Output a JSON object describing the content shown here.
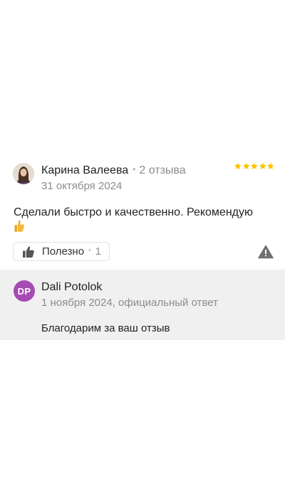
{
  "review": {
    "author_name": "Карина Валеева",
    "separator": "•",
    "reviews_count": "2 отзыва",
    "rating": 5,
    "star_color": "#fcc200",
    "date": "31 октября 2024",
    "text": "Сделали быстро и качественно. Рекомендую",
    "text_emoji": "thumbs-up-emoji",
    "helpful": {
      "label": "Полезно",
      "separator": "•",
      "count": "1"
    },
    "report_icon": "warning-icon"
  },
  "reply": {
    "avatar_initials": "DP",
    "avatar_color": "#a54bb3",
    "author_name": "Dali Potolok",
    "meta": "1 ноября 2024, официальный ответ",
    "text": "Благодарим за ваш отзыв"
  }
}
